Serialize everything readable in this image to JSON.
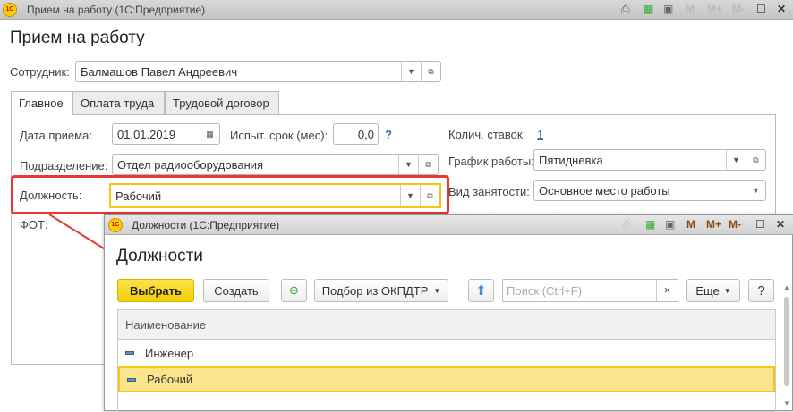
{
  "main_window": {
    "title": "Прием на работу  (1С:Предприятие)",
    "heading": "Прием на работу",
    "titlebar_icons": [
      "print-icon",
      "calculator-icon",
      "calendar-icon",
      "M",
      "M+",
      "M-",
      "maximize-icon",
      "close-icon"
    ],
    "employee": {
      "label": "Сотрудник:",
      "value": "Балмашов Павел Андреевич"
    },
    "tabs": [
      {
        "label": "Главное",
        "active": true
      },
      {
        "label": "Оплата труда"
      },
      {
        "label": "Трудовой договор"
      }
    ],
    "fields": {
      "hire_date": {
        "label": "Дата приема:",
        "value": "01.01.2019"
      },
      "probation": {
        "label": "Испыт. срок (мес):",
        "value": "0,0",
        "help": "?"
      },
      "rates": {
        "label": "Колич. ставок:",
        "value": "1"
      },
      "department": {
        "label": "Подразделение:",
        "value": "Отдел радиооборудования"
      },
      "schedule": {
        "label": "График работы:",
        "value": "Пятидневка"
      },
      "position": {
        "label": "Должность:",
        "value": "Рабочий"
      },
      "employment_type": {
        "label": "Вид занятости:",
        "value": "Основное место работы"
      },
      "payroll": {
        "label": "ФОТ:"
      }
    }
  },
  "popup": {
    "title": "Должности  (1С:Предприятие)",
    "heading": "Должности",
    "m": "M",
    "mplus": "M+",
    "mminus": "M-",
    "toolbar": {
      "select": "Выбрать",
      "create": "Создать",
      "okpdtr": "Подбор из ОКПДТР",
      "search_placeholder": "Поиск (Ctrl+F)",
      "clear": "×",
      "more": "Еще",
      "help": "?"
    },
    "table": {
      "header": "Наименование",
      "rows": [
        {
          "name": "Инженер",
          "selected": false
        },
        {
          "name": "Рабочий",
          "selected": true
        }
      ]
    }
  },
  "colors": {
    "accent_yellow": "#f5d31c",
    "highlight_row": "#fce48e",
    "annotation_red": "#e53935",
    "link": "#2a6fb5"
  }
}
